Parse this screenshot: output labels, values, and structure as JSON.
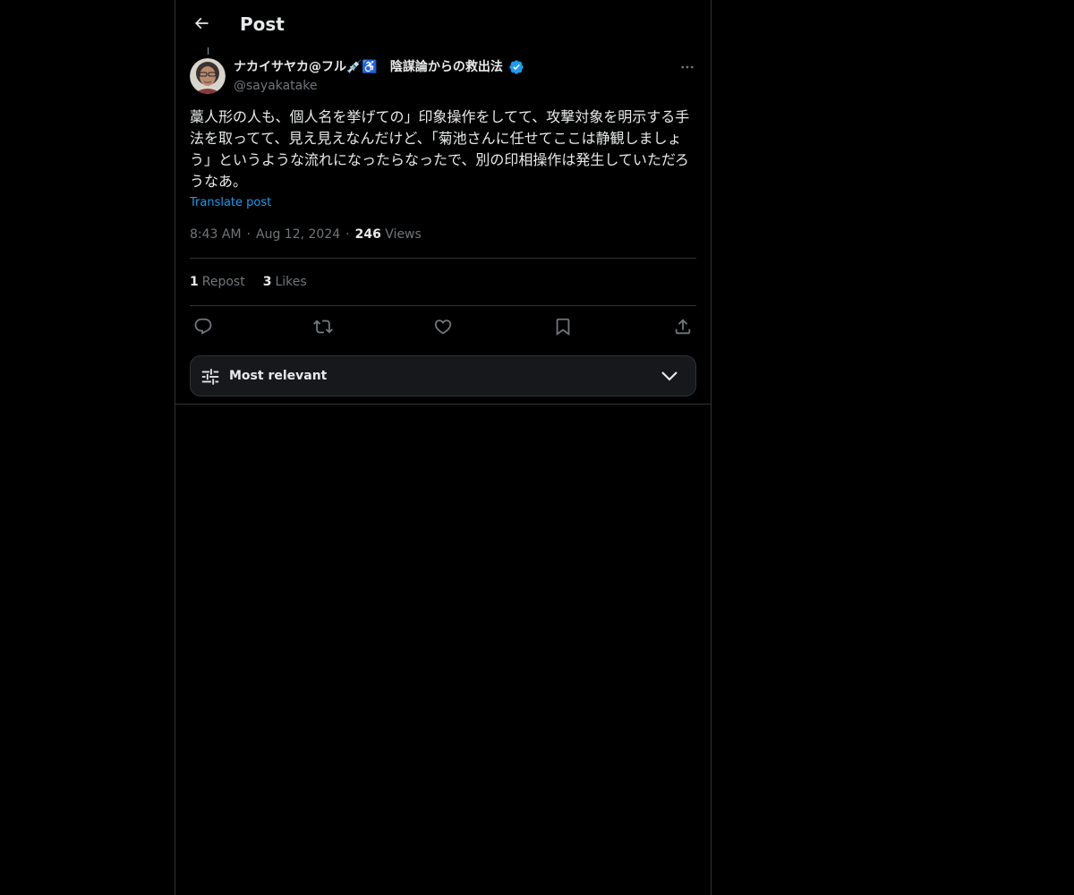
{
  "header": {
    "title": "Post"
  },
  "author": {
    "name": "ナカイサヤカ@フル💉♿️　陰謀論からの救出法",
    "handle": "@sayakatake",
    "verified": true
  },
  "post": {
    "text": "藁人形の人も、個人名を挙げての」印象操作をしてて、攻撃対象を明示する手法を取ってて、見え見えなんだけど、「菊池さんに任せてここは静観しましょう」というような流れになったらなったで、別の印相操作は発生していただろうなあ。",
    "translate_label": "Translate post",
    "time": "8:43 AM",
    "date": "Aug 12, 2024",
    "views_count": "246",
    "views_label": "Views",
    "separator": "·"
  },
  "stats": {
    "reposts_count": "1",
    "reposts_label": "Repost",
    "likes_count": "3",
    "likes_label": "Likes"
  },
  "sort": {
    "label": "Most relevant"
  },
  "colors": {
    "background": "#000000",
    "text": "#e7e9ea",
    "muted": "#71767b",
    "accent": "#1d9bf0",
    "border": "#2f3336"
  },
  "icons": {
    "back": "arrow-left-icon",
    "verified": "verified-badge-icon",
    "more": "more-dots-icon",
    "reply": "reply-icon",
    "repost": "repost-icon",
    "like": "heart-icon",
    "bookmark": "bookmark-icon",
    "share": "share-icon",
    "sort": "sliders-icon",
    "chevron": "chevron-down-icon"
  }
}
